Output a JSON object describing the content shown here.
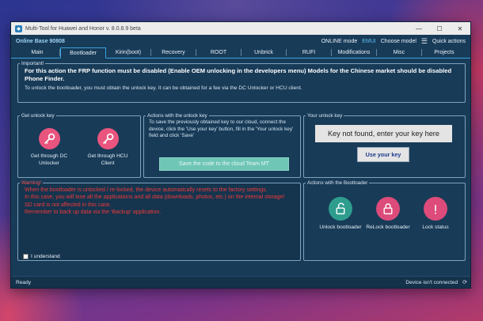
{
  "window": {
    "title": "Multi-Tool for Huawei and Honor v. 8.0.8.9 beta",
    "min_glyph": "—",
    "max_glyph": "☐",
    "close_glyph": "✕"
  },
  "topbar": {
    "base": "Online Base 90808",
    "online_mode": "ONLINE mode",
    "emui": "EMUI",
    "choose_model": "Choose model",
    "quick_actions": "Quick actions"
  },
  "tabs": [
    {
      "label": "Main",
      "active": false
    },
    {
      "label": "Bootloader",
      "active": true
    },
    {
      "label": "Kirin(boot)",
      "active": false
    },
    {
      "label": "Recovery",
      "active": false
    },
    {
      "label": "ROOT",
      "active": false
    },
    {
      "label": "Unbrick",
      "active": false
    },
    {
      "label": "RUFI",
      "active": false
    },
    {
      "label": "Modifications",
      "active": false
    },
    {
      "label": "Misc",
      "active": false
    },
    {
      "label": "Projects",
      "active": false
    }
  ],
  "important": {
    "legend": "Important!",
    "strong": "For this action the FRP function must be disabled (Enable OEM unlocking in the developers menu) Models for the Chinese market should be disabled Phone Finder.",
    "normal": "To unlock the bootloader, you must obtain the unlock key. It can be obtained for a fee via the DC Unlocker or HCU client."
  },
  "get_key": {
    "legend": "Get unlock key",
    "dc": "Get through DC Unlocker",
    "hcu": "Get through HCU Client"
  },
  "actions_key": {
    "legend": "Actions with the unlock key",
    "desc": "To save the previously obtained key to our cloud, connect the device, click the 'Use your key' button, fill in the 'Your unlock key' field and click 'Save'",
    "save_button": "Save the code to the cloud Team MT"
  },
  "your_key": {
    "legend": "Your unlock key",
    "status": "Key not found, enter your key here",
    "use_button": "Use your key"
  },
  "warning": {
    "legend": "Warning!",
    "lines": [
      "When the bootloader is unlocked / re-locked, the device automatically resets to the factory settings.",
      "In this case, you will lose all the applications and all data (downloads, photos, etc.) on the internal storage! SD card is not affected in this case.",
      "Remember to back up data via the 'Backup' application."
    ],
    "understand": "I understand"
  },
  "bootloader_actions": {
    "legend": "Actions with the Bootloader",
    "unlock": "Unlock bootloader",
    "relock": "ReLock bootloader",
    "lock_status": "Lock status"
  },
  "status": {
    "left": "Ready",
    "right": "Device isn't connected"
  },
  "colors": {
    "accent": "#3aa3dd",
    "pink": "#e9557e",
    "teal": "#2e9d8e",
    "warning": "#f03a3a",
    "window_bg": "#183b58"
  },
  "icons": {
    "key": "key-icon",
    "unlock": "open-padlock-icon",
    "relock": "closed-padlock-icon",
    "status": "info-icon"
  }
}
